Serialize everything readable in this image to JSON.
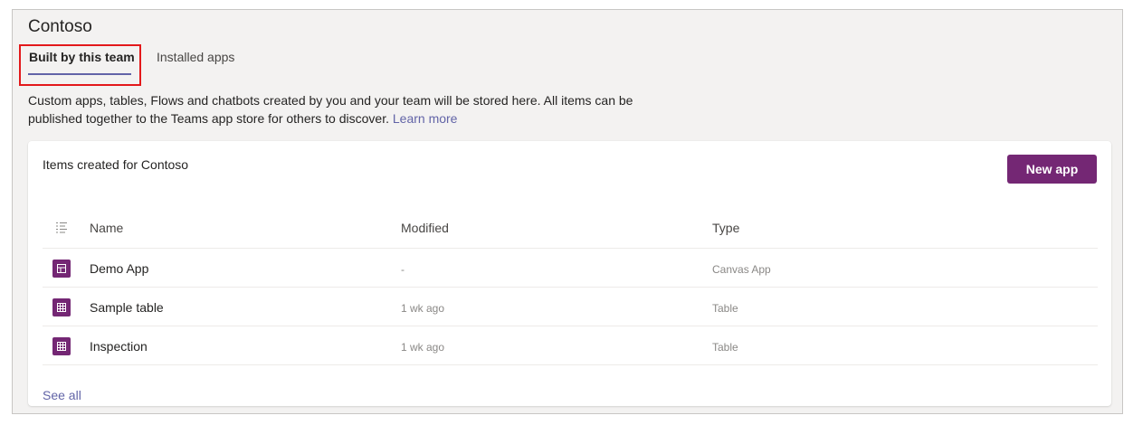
{
  "team": {
    "title": "Contoso"
  },
  "tabs": [
    {
      "label": "Built by this team",
      "active": true
    },
    {
      "label": "Installed apps",
      "active": false
    }
  ],
  "description": {
    "text": "Custom apps, tables, Flows and chatbots created by you and your team will be stored here. All items can be published together to the Teams app store for others to discover.",
    "link_label": "Learn more"
  },
  "card": {
    "title": "Items created for Contoso",
    "new_app_label": "New app",
    "columns": {
      "name": "Name",
      "modified": "Modified",
      "type": "Type"
    },
    "rows": [
      {
        "icon": "canvas-app-icon",
        "name": "Demo App",
        "modified": "-",
        "type": "Canvas App"
      },
      {
        "icon": "table-icon",
        "name": "Sample table",
        "modified": "1 wk ago",
        "type": "Table"
      },
      {
        "icon": "table-icon",
        "name": "Inspection",
        "modified": "1 wk ago",
        "type": "Table"
      }
    ],
    "see_all_label": "See all"
  },
  "colors": {
    "accent": "#6264a7",
    "brand_purple": "#742774",
    "highlight_red": "#e3191b",
    "panel_bg": "#f3f2f1"
  }
}
